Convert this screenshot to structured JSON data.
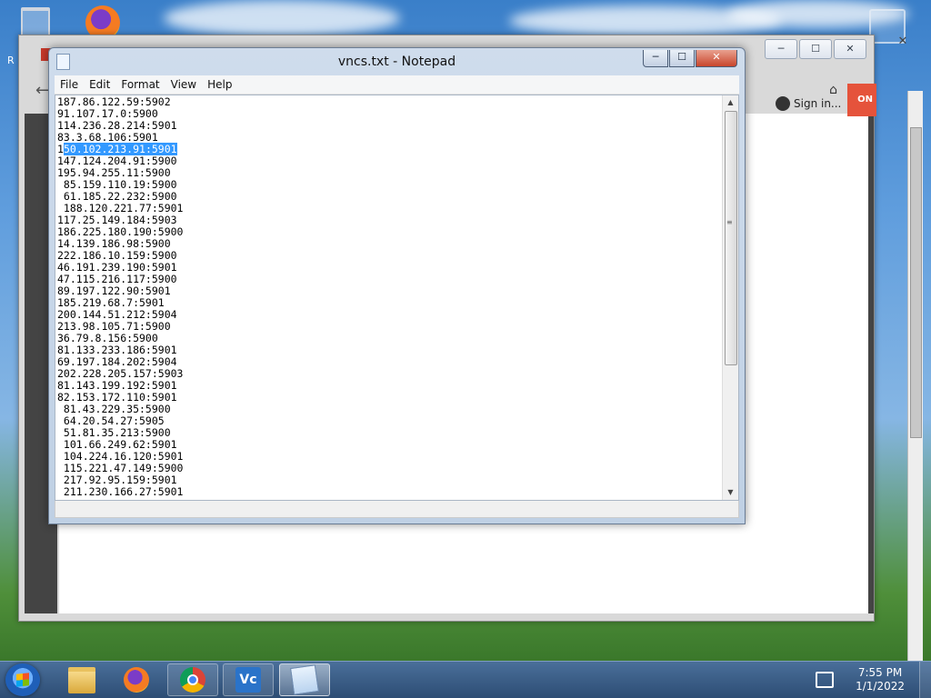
{
  "desktop": {
    "edge_label": "R"
  },
  "browser": {
    "sign_in_label": "Sign in...",
    "action_button_label": "ON",
    "controls": [
      "─",
      "☐",
      "✕"
    ]
  },
  "notepad": {
    "title": "vncs.txt - Notepad",
    "controls": {
      "minimize": "─",
      "maximize": "☐",
      "close": "✕"
    },
    "menu": [
      "File",
      "Edit",
      "Format",
      "View",
      "Help"
    ],
    "lines": [
      "187.86.122.59:5902",
      "91.107.17.0:5900",
      "114.236.28.214:5901",
      "83.3.68.106:5901",
      "150.102.213.91:5901",
      "147.124.204.91:5900",
      "195.94.255.11:5900",
      " 85.159.110.19:5900",
      " 61.185.22.232:5900",
      " 188.120.221.77:5901",
      "117.25.149.184:5903",
      "186.225.180.190:5900",
      "14.139.186.98:5900",
      "222.186.10.159:5900",
      "46.191.239.190:5901",
      "47.115.216.117:5900",
      "89.197.122.90:5901",
      "185.219.68.7:5901",
      "200.144.51.212:5904",
      "213.98.105.71:5900",
      "36.79.8.156:5900",
      "81.133.233.186:5901",
      "69.197.184.202:5904",
      "202.228.205.157:5903",
      "81.143.199.192:5901",
      "82.153.172.110:5901",
      " 81.43.229.35:5900",
      " 64.20.54.27:5905",
      " 51.81.35.213:5900",
      " 101.66.249.62:5901",
      " 104.224.16.120:5901",
      " 115.221.47.149:5900",
      " 217.92.95.159:5901",
      " 211.230.166.27:5901"
    ],
    "selection": {
      "line_index": 4,
      "before": "1",
      "selected": "50.102.213.91:5901"
    }
  },
  "taskbar": {
    "apps": [
      {
        "name": "Windows Explorer",
        "icon": "folder-icon"
      },
      {
        "name": "Firefox",
        "icon": "firefox-icon"
      },
      {
        "name": "Google Chrome",
        "icon": "chrome-icon"
      },
      {
        "name": "VNC Viewer",
        "icon": "vnc-icon",
        "text": "Vc"
      },
      {
        "name": "Notepad",
        "icon": "notepad-icon"
      }
    ],
    "time": "7:55 PM",
    "date": "1/1/2022"
  }
}
